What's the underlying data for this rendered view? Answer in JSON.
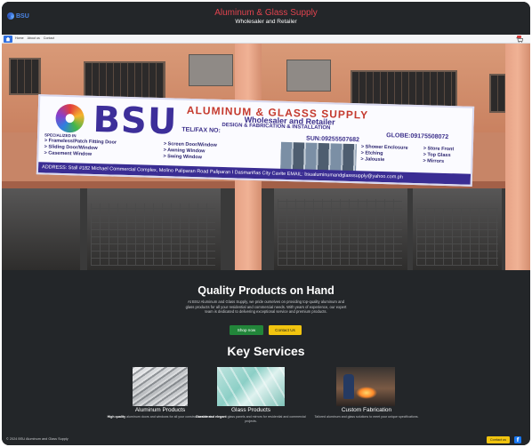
{
  "header": {
    "logo_text": "BSU",
    "title": "Aluminum & Glass Supply",
    "subtitle": "Wholesaler and Retailer"
  },
  "nav": {
    "items": [
      "Home",
      "About us",
      "Contact"
    ]
  },
  "hero_sign": {
    "brand": "BSU",
    "name": "ALUMINUM & GLASSS SUPPLY",
    "tagline": "Wholesaler and Retailer",
    "services_line": "DESIGN & FABRICATION & INSTALLATION",
    "tel": "TEL/FAX NO:",
    "sun": "SUN:09255507682",
    "globe": "GLOBE:09175508072",
    "specialized_in": "SPECIALIZED IN",
    "list_left": [
      "> Frameless/Patch Fitting Door",
      "> Sliding Door/Window",
      "> Casement Window"
    ],
    "list_mid": [
      "> Screen Door/Window",
      "> Awning Window",
      "> Swing Window"
    ],
    "list_right": [
      "> Shower Enclosure",
      "> Etching",
      "> Jalousie"
    ],
    "list_far": [
      "> Store Front",
      "> Top Glass",
      "> Mirrors"
    ],
    "address": "ADDRESS: Stall #182 Michael Commercial Complex, Molino Paliparan Road Paliparan I Dasmariñas City Cavite    EMAIL: bsualuminumandglasssupply@yahoo.com.ph"
  },
  "intro": {
    "title": "Quality Products on Hand",
    "text": "At BSU Aluminum and Glass Supply, we pride ourselves on providing top-quality aluminum and glass products for all your residential and commercial needs. With years of experience, our expert team is dedicated to delivering exceptional service and premium products.",
    "shop_button": "Shop now",
    "contact_button": "Contact Us"
  },
  "services": {
    "title": "Key Services",
    "cards": [
      {
        "title": "Aluminum Products",
        "desc_bold": "High quality",
        "desc": " aluminum doors and windows for all your construction needs."
      },
      {
        "title": "Glass Products",
        "desc_bold": "Durable and elegant",
        "desc": " glass panels and mirrors for residential and commercial projects."
      },
      {
        "title": "Custom Fabrication",
        "desc_bold": "",
        "desc": "Tailored aluminum and glass solutions to meet your unique specifications."
      }
    ]
  },
  "footer": {
    "copyright": "© 2024 BSU Aluminum and Glass Supply",
    "contact_button": "Contact us",
    "facebook_icon": "f"
  }
}
